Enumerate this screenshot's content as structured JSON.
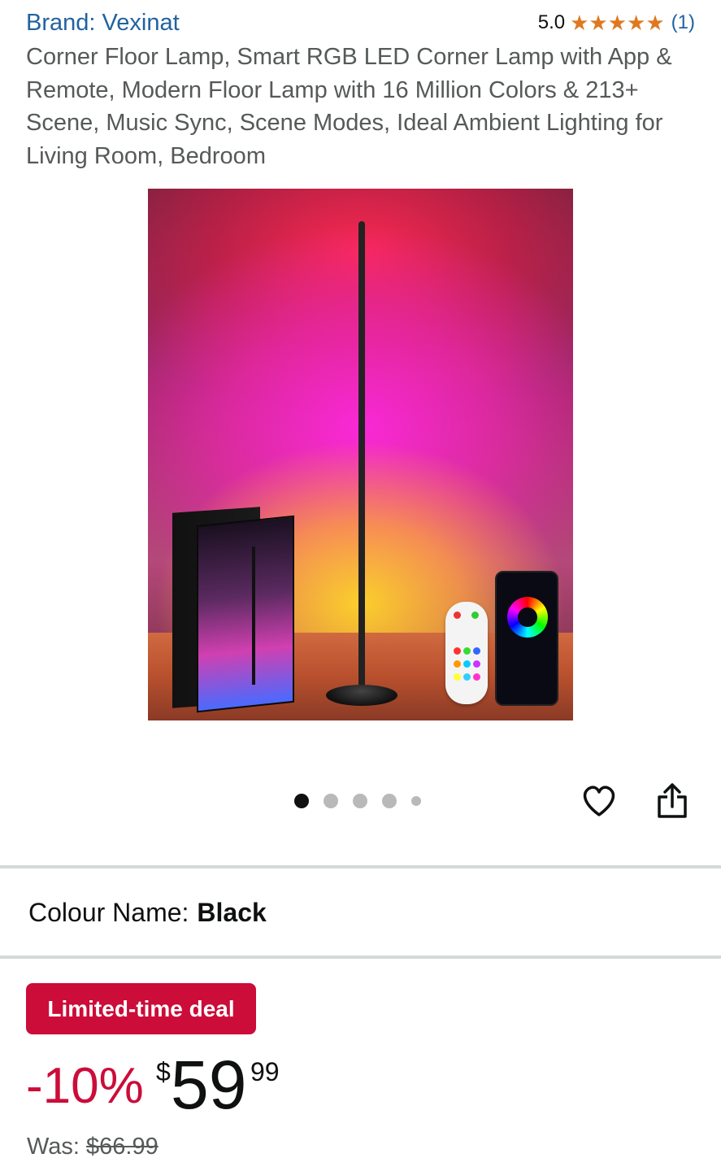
{
  "brand": {
    "label": "Brand: Vexinat"
  },
  "rating": {
    "value": "5.0",
    "stars": 5,
    "count": "(1)",
    "star_color": "#de7921"
  },
  "product": {
    "title": "Corner Floor Lamp, Smart RGB LED Corner Lamp with App & Remote, Modern Floor Lamp with 16 Million Colors & 213+ Scene, Music Sync, Scene Modes, Ideal Ambient Lighting for Living Room, Bedroom"
  },
  "gallery": {
    "count": 5,
    "active_index": 0
  },
  "actions": {
    "wishlist_icon": "heart-icon",
    "share_icon": "share-icon"
  },
  "colour": {
    "label": "Colour Name:",
    "value": "Black"
  },
  "deal": {
    "label": "Limited-time deal",
    "color": "#cc0c39"
  },
  "price": {
    "discount": "-10%",
    "currency": "$",
    "whole": "59",
    "fraction": "99"
  },
  "was": {
    "label": "Was:",
    "value": "$66.99"
  },
  "colors": {
    "link": "#2162a1",
    "text": "#0f1111",
    "muted": "#565959"
  }
}
